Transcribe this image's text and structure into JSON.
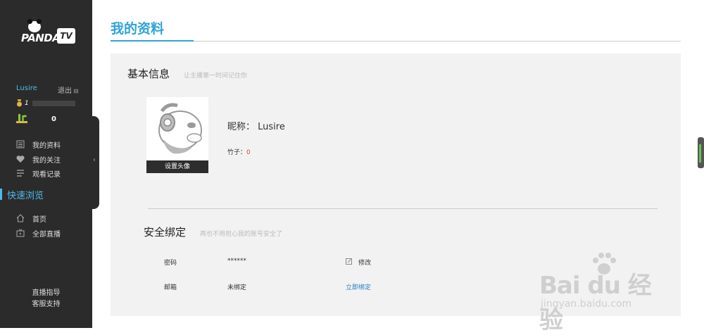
{
  "sidebar": {
    "logo_text": "PANDA",
    "logo_tv": "TV",
    "username": "Lusire",
    "logout": "退出",
    "level": "1",
    "bamboo_count": "0",
    "menu": [
      {
        "label": "我的资料",
        "icon": "profile-icon"
      },
      {
        "label": "我的关注",
        "icon": "heart-icon"
      },
      {
        "label": "观看记录",
        "icon": "history-icon"
      }
    ],
    "quick_browse": "快速浏览",
    "nav": [
      {
        "label": "首页",
        "icon": "home-icon"
      },
      {
        "label": "全部直播",
        "icon": "tv-icon"
      }
    ],
    "footer": [
      "直播指导",
      "客服支持"
    ]
  },
  "main": {
    "page_title": "我的资料",
    "basic": {
      "title": "基本信息",
      "subtitle": "让主播第一时间记住你",
      "set_avatar": "设置头像",
      "nickname_label": "昵称：",
      "nickname": "Lusire",
      "bamboo_label": "竹子：",
      "bamboo_value": "0"
    },
    "security": {
      "title": "安全绑定",
      "subtitle": "再也不用担心我的账号安全了",
      "rows": [
        {
          "label": "密码",
          "value": "******",
          "action": "修改"
        },
        {
          "label": "邮箱",
          "value": "未绑定",
          "action": "立即绑定"
        }
      ]
    }
  },
  "watermark": {
    "big": "Bai du 经验",
    "small": "jingyan.baidu.com"
  },
  "colors": {
    "accent": "#2fa4d8",
    "sidebar_bg": "#2b2b2b",
    "panel_bg": "#f2f2f2",
    "bamboo_value": "#d9463b",
    "link": "#2a7cc7"
  }
}
